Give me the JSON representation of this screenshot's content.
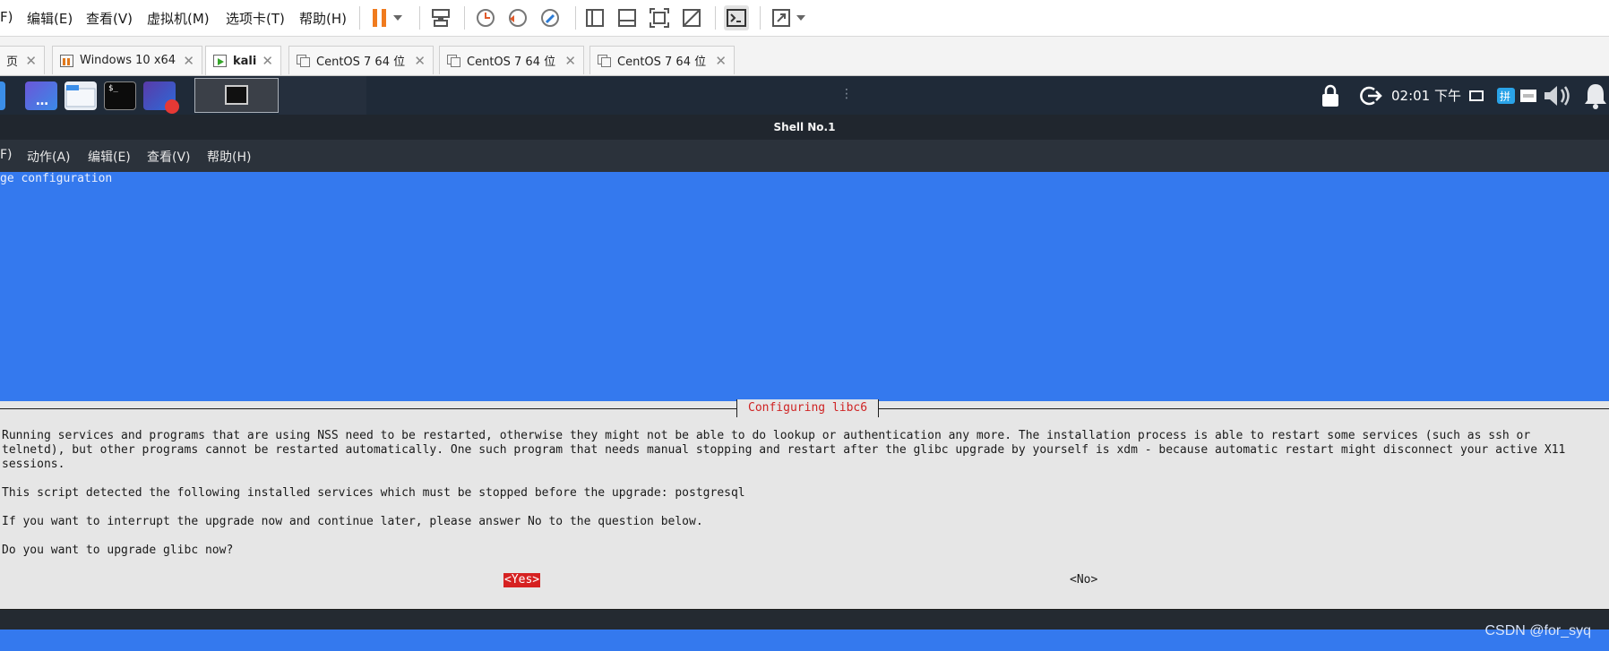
{
  "vm_menu": [
    "F)",
    "编辑(E)",
    "查看(V)",
    "虚拟机(M)",
    "选项卡(T)",
    "帮助(H)"
  ],
  "tabs": [
    {
      "label": "页"
    },
    {
      "label": "Windows 10 x64"
    },
    {
      "label": "kali"
    },
    {
      "label": "CentOS 7 64 位"
    },
    {
      "label": "CentOS 7 64 位"
    },
    {
      "label": "CentOS 7 64 位"
    }
  ],
  "taskbar": {
    "clock": "02:01 下午",
    "handle": "⋮"
  },
  "terminal": {
    "title": "Shell No.1",
    "menu": [
      "F)",
      "动作(A)",
      "编辑(E)",
      "查看(V)",
      "帮助(H)"
    ]
  },
  "dialog": {
    "background_title": "ge configuration",
    "title": "Configuring libc6",
    "line1": "Running services and programs that are using NSS need to be restarted, otherwise they might not be able to do lookup or authentication any more. The installation process is able to restart some services (such as ssh or",
    "line2": "telnetd), but other programs cannot be restarted automatically. One such program that needs manual stopping and restart after the glibc upgrade by yourself is xdm - because automatic restart might disconnect your active X11",
    "line3": "sessions.",
    "services": "This script detected the following installed services which must be stopped before the upgrade: postgresql",
    "interrupt": "If you want to interrupt the upgrade now and continue later, please answer No to the question below.",
    "question": "Do you want to upgrade glibc now?",
    "yes": "<Yes>",
    "no": "<No>"
  },
  "watermark": "CSDN @for_syq",
  "colors": {
    "dialog_blue": "#3479ee",
    "dialog_grey": "#e6e6e6",
    "title_red": "#cf2323",
    "yes_bg": "#d62121",
    "kali_bar": "#1f2a38"
  }
}
